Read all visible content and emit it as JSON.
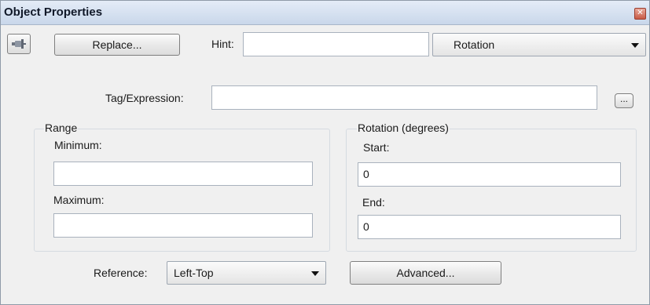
{
  "window": {
    "title": "Object Properties"
  },
  "toolbar": {
    "replace_label": "Replace...",
    "hint_label": "Hint:",
    "hint_value": "",
    "animation_type": "Rotation"
  },
  "tag_expression": {
    "label": "Tag/Expression:",
    "value": "",
    "browse_label": "..."
  },
  "range": {
    "legend": "Range",
    "minimum_label": "Minimum:",
    "minimum_value": "",
    "maximum_label": "Maximum:",
    "maximum_value": ""
  },
  "rotation": {
    "legend": "Rotation (degrees)",
    "start_label": "Start:",
    "start_value": "0",
    "end_label": "End:",
    "end_value": "0"
  },
  "reference": {
    "label": "Reference:",
    "value": "Left-Top"
  },
  "advanced_label": "Advanced...",
  "icons": {
    "close": "close-icon",
    "pin": "pin-icon"
  },
  "colors": {
    "titlebar": "#c9d7ea",
    "close": "#c85a45"
  }
}
